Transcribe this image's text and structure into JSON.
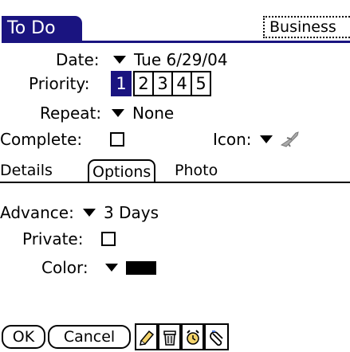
{
  "header": {
    "title": "To Do",
    "category": "Business"
  },
  "form": {
    "date_label": "Date:",
    "date_value": "Tue 6/29/04",
    "priority_label": "Priority:",
    "priority_options": [
      "1",
      "2",
      "3",
      "4",
      "5"
    ],
    "priority_selected": "1",
    "repeat_label": "Repeat:",
    "repeat_value": "None",
    "complete_label": "Complete:",
    "icon_label": "Icon:"
  },
  "tabs": [
    "Details",
    "Options",
    "Photo"
  ],
  "options": {
    "advance_label": "Advance:",
    "advance_value": "3 Days",
    "private_label": "Private:",
    "color_label": "Color:",
    "color_value": "#000000"
  },
  "footer": {
    "ok_label": "OK",
    "cancel_label": "Cancel"
  },
  "colors": {
    "accent": "#1a1480"
  }
}
